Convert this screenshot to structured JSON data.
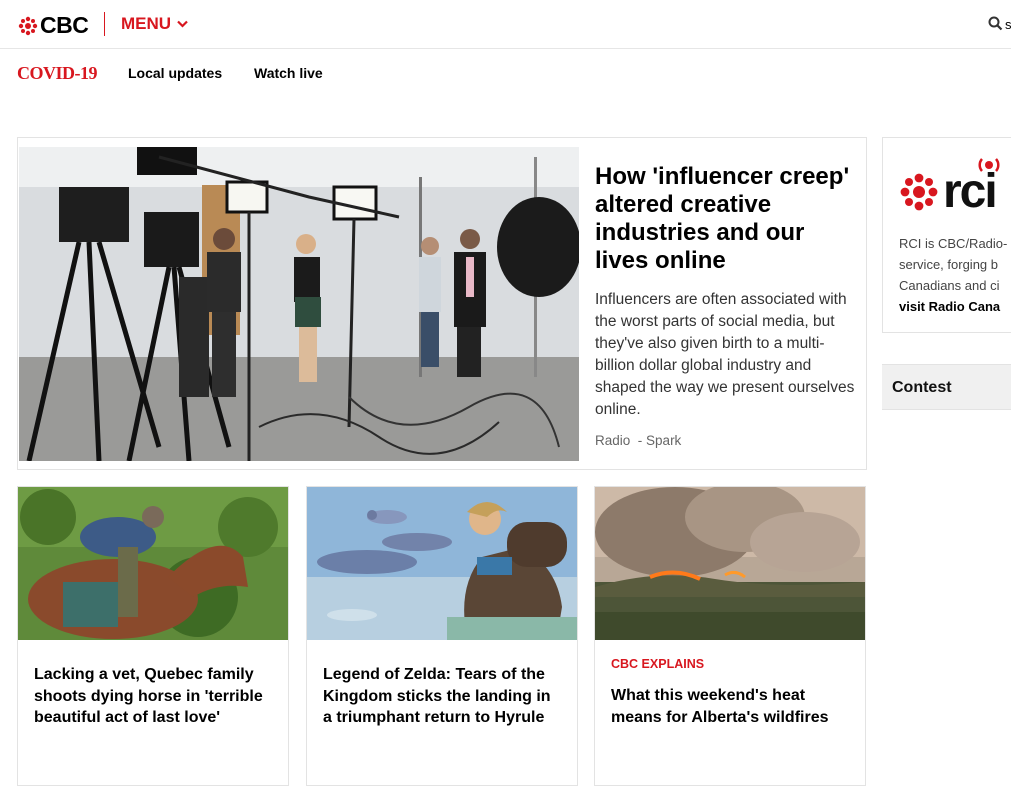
{
  "header": {
    "logo_text": "CBC",
    "menu_label": "MENU",
    "search_truncated": "s",
    "icons": {
      "logo": "cbc-gem-icon",
      "menu": "chevron-down-icon",
      "search": "search-icon"
    },
    "colors": {
      "brand_red": "#d8171f"
    }
  },
  "subnav": {
    "covid_label": "COVID-19",
    "links": [
      "Local updates",
      "Watch live"
    ]
  },
  "hero": {
    "title": "How 'influencer creep' altered creative industries and our lives online",
    "description": "Influencers are often associated with the worst parts of social media, but they've also given birth to a multi-billion dollar global industry and shaped the way we present ourselves online.",
    "meta_section": "Radio",
    "meta_show": "- Spark"
  },
  "cards": [
    {
      "kicker": "",
      "title": "Lacking a vet, Quebec family shoots dying horse in 'terrible beautiful act of last love'"
    },
    {
      "kicker": "",
      "title": "Legend of Zelda: Tears of the Kingdom sticks the landing in a triumphant return to Hyrule"
    },
    {
      "kicker": "CBC EXPLAINS",
      "title": "What this weekend's heat means for Alberta's wildfires"
    }
  ],
  "rci": {
    "logo_text": "rci",
    "lines": [
      "RCI is CBC/Radio-",
      "service, forging b",
      "Canadians and ci"
    ],
    "link": "visit Radio Cana"
  },
  "contest": {
    "label": "Contest"
  }
}
